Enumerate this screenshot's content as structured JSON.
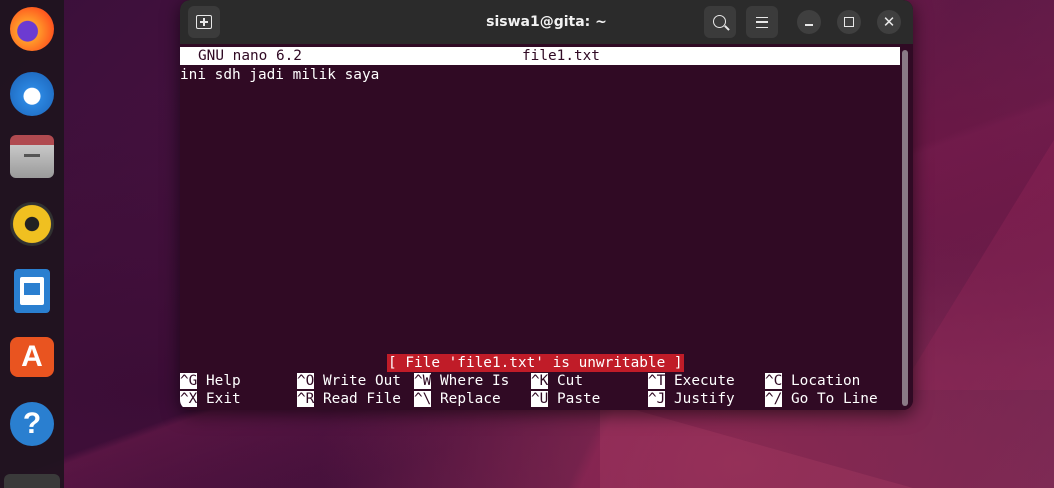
{
  "window": {
    "title": "siswa1@gita: ~"
  },
  "dock": {
    "apps": [
      {
        "name": "firefox-icon"
      },
      {
        "name": "thunderbird-icon"
      },
      {
        "name": "files-icon"
      },
      {
        "name": "rhythmbox-icon"
      },
      {
        "name": "libreoffice-writer-icon"
      },
      {
        "name": "ubuntu-software-icon",
        "glyph": "A"
      },
      {
        "name": "help-icon",
        "glyph": "?"
      }
    ]
  },
  "nano": {
    "header_left": "GNU nano 6.2",
    "header_filename": "file1.txt",
    "content_lines": [
      "ini sdh jadi milik saya"
    ],
    "status_message": "[ File 'file1.txt' is unwritable ]",
    "shortcuts_row1": [
      {
        "key": "^G",
        "label": "Help"
      },
      {
        "key": "^O",
        "label": "Write Out"
      },
      {
        "key": "^W",
        "label": "Where Is"
      },
      {
        "key": "^K",
        "label": "Cut"
      },
      {
        "key": "^T",
        "label": "Execute"
      },
      {
        "key": "^C",
        "label": "Location"
      }
    ],
    "shortcuts_row2": [
      {
        "key": "^X",
        "label": "Exit"
      },
      {
        "key": "^R",
        "label": "Read File"
      },
      {
        "key": "^\\",
        "label": "Replace"
      },
      {
        "key": "^U",
        "label": "Paste"
      },
      {
        "key": "^J",
        "label": "Justify"
      },
      {
        "key": "^/",
        "label": "Go To Line"
      }
    ]
  },
  "colors": {
    "terminal_bg": "#300a24",
    "titlebar_bg": "#2b2b2b",
    "status_bg": "#c01c28",
    "accent_orange": "#e95420"
  }
}
